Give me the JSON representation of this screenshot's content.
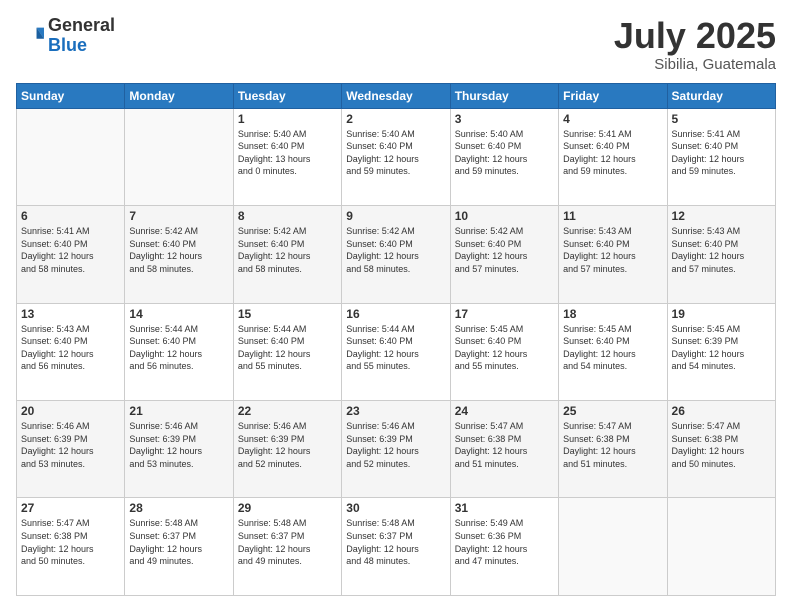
{
  "header": {
    "logo_general": "General",
    "logo_blue": "Blue",
    "month": "July 2025",
    "location": "Sibilia, Guatemala"
  },
  "days_of_week": [
    "Sunday",
    "Monday",
    "Tuesday",
    "Wednesday",
    "Thursday",
    "Friday",
    "Saturday"
  ],
  "weeks": [
    [
      {
        "day": "",
        "info": ""
      },
      {
        "day": "",
        "info": ""
      },
      {
        "day": "1",
        "info": "Sunrise: 5:40 AM\nSunset: 6:40 PM\nDaylight: 13 hours\nand 0 minutes."
      },
      {
        "day": "2",
        "info": "Sunrise: 5:40 AM\nSunset: 6:40 PM\nDaylight: 12 hours\nand 59 minutes."
      },
      {
        "day": "3",
        "info": "Sunrise: 5:40 AM\nSunset: 6:40 PM\nDaylight: 12 hours\nand 59 minutes."
      },
      {
        "day": "4",
        "info": "Sunrise: 5:41 AM\nSunset: 6:40 PM\nDaylight: 12 hours\nand 59 minutes."
      },
      {
        "day": "5",
        "info": "Sunrise: 5:41 AM\nSunset: 6:40 PM\nDaylight: 12 hours\nand 59 minutes."
      }
    ],
    [
      {
        "day": "6",
        "info": "Sunrise: 5:41 AM\nSunset: 6:40 PM\nDaylight: 12 hours\nand 58 minutes."
      },
      {
        "day": "7",
        "info": "Sunrise: 5:42 AM\nSunset: 6:40 PM\nDaylight: 12 hours\nand 58 minutes."
      },
      {
        "day": "8",
        "info": "Sunrise: 5:42 AM\nSunset: 6:40 PM\nDaylight: 12 hours\nand 58 minutes."
      },
      {
        "day": "9",
        "info": "Sunrise: 5:42 AM\nSunset: 6:40 PM\nDaylight: 12 hours\nand 58 minutes."
      },
      {
        "day": "10",
        "info": "Sunrise: 5:42 AM\nSunset: 6:40 PM\nDaylight: 12 hours\nand 57 minutes."
      },
      {
        "day": "11",
        "info": "Sunrise: 5:43 AM\nSunset: 6:40 PM\nDaylight: 12 hours\nand 57 minutes."
      },
      {
        "day": "12",
        "info": "Sunrise: 5:43 AM\nSunset: 6:40 PM\nDaylight: 12 hours\nand 57 minutes."
      }
    ],
    [
      {
        "day": "13",
        "info": "Sunrise: 5:43 AM\nSunset: 6:40 PM\nDaylight: 12 hours\nand 56 minutes."
      },
      {
        "day": "14",
        "info": "Sunrise: 5:44 AM\nSunset: 6:40 PM\nDaylight: 12 hours\nand 56 minutes."
      },
      {
        "day": "15",
        "info": "Sunrise: 5:44 AM\nSunset: 6:40 PM\nDaylight: 12 hours\nand 55 minutes."
      },
      {
        "day": "16",
        "info": "Sunrise: 5:44 AM\nSunset: 6:40 PM\nDaylight: 12 hours\nand 55 minutes."
      },
      {
        "day": "17",
        "info": "Sunrise: 5:45 AM\nSunset: 6:40 PM\nDaylight: 12 hours\nand 55 minutes."
      },
      {
        "day": "18",
        "info": "Sunrise: 5:45 AM\nSunset: 6:40 PM\nDaylight: 12 hours\nand 54 minutes."
      },
      {
        "day": "19",
        "info": "Sunrise: 5:45 AM\nSunset: 6:39 PM\nDaylight: 12 hours\nand 54 minutes."
      }
    ],
    [
      {
        "day": "20",
        "info": "Sunrise: 5:46 AM\nSunset: 6:39 PM\nDaylight: 12 hours\nand 53 minutes."
      },
      {
        "day": "21",
        "info": "Sunrise: 5:46 AM\nSunset: 6:39 PM\nDaylight: 12 hours\nand 53 minutes."
      },
      {
        "day": "22",
        "info": "Sunrise: 5:46 AM\nSunset: 6:39 PM\nDaylight: 12 hours\nand 52 minutes."
      },
      {
        "day": "23",
        "info": "Sunrise: 5:46 AM\nSunset: 6:39 PM\nDaylight: 12 hours\nand 52 minutes."
      },
      {
        "day": "24",
        "info": "Sunrise: 5:47 AM\nSunset: 6:38 PM\nDaylight: 12 hours\nand 51 minutes."
      },
      {
        "day": "25",
        "info": "Sunrise: 5:47 AM\nSunset: 6:38 PM\nDaylight: 12 hours\nand 51 minutes."
      },
      {
        "day": "26",
        "info": "Sunrise: 5:47 AM\nSunset: 6:38 PM\nDaylight: 12 hours\nand 50 minutes."
      }
    ],
    [
      {
        "day": "27",
        "info": "Sunrise: 5:47 AM\nSunset: 6:38 PM\nDaylight: 12 hours\nand 50 minutes."
      },
      {
        "day": "28",
        "info": "Sunrise: 5:48 AM\nSunset: 6:37 PM\nDaylight: 12 hours\nand 49 minutes."
      },
      {
        "day": "29",
        "info": "Sunrise: 5:48 AM\nSunset: 6:37 PM\nDaylight: 12 hours\nand 49 minutes."
      },
      {
        "day": "30",
        "info": "Sunrise: 5:48 AM\nSunset: 6:37 PM\nDaylight: 12 hours\nand 48 minutes."
      },
      {
        "day": "31",
        "info": "Sunrise: 5:49 AM\nSunset: 6:36 PM\nDaylight: 12 hours\nand 47 minutes."
      },
      {
        "day": "",
        "info": ""
      },
      {
        "day": "",
        "info": ""
      }
    ]
  ]
}
